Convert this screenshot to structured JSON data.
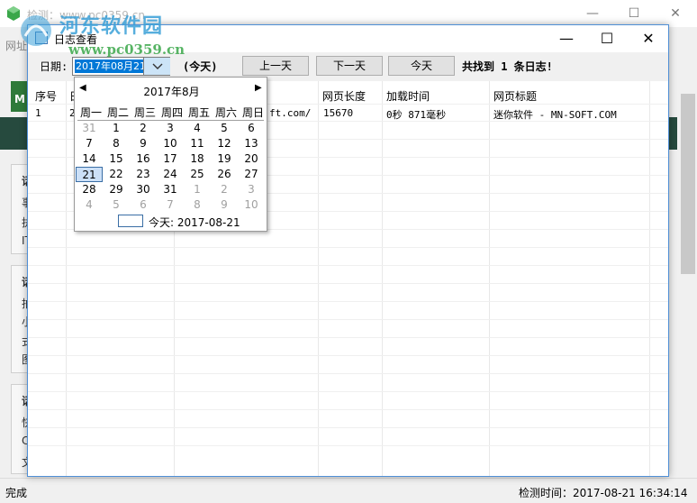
{
  "background_window": {
    "title": "检测：www.pc0359.cn",
    "url_label": "网址",
    "m_logo": "M",
    "side_glyphs": [
      "话",
      "事",
      "执",
      "IT",
      "话",
      "拍",
      "小",
      "式",
      "图",
      "话",
      "快",
      "C",
      "文"
    ],
    "status_left": "完成",
    "status_right": "检测时间：2017-08-21 16:34:14"
  },
  "watermark": {
    "text": "河东软件园",
    "url": "www.pc0359.cn"
  },
  "dialog": {
    "title": "日志查看",
    "date_label": "日期:",
    "date_value": "2017年08月21",
    "today_paren": "(今天)",
    "btn_prev": "上一天",
    "btn_next": "下一天",
    "btn_today": "今天",
    "found_text": "共找到 1 条日志!"
  },
  "table": {
    "headers": [
      "序号",
      "日",
      "网页长度",
      "加载时间",
      "网页标题"
    ],
    "rows": [
      [
        "1",
        "2",
        "ft.com/",
        "15670",
        "0秒 871毫秒",
        "迷你软件 - MN-SOFT.COM"
      ]
    ]
  },
  "calendar": {
    "title": "2017年8月",
    "weekdays": [
      "周一",
      "周二",
      "周三",
      "周四",
      "周五",
      "周六",
      "周日"
    ],
    "weeks": [
      [
        "31",
        "1",
        "2",
        "3",
        "4",
        "5",
        "6"
      ],
      [
        "7",
        "8",
        "9",
        "10",
        "11",
        "12",
        "13"
      ],
      [
        "14",
        "15",
        "16",
        "17",
        "18",
        "19",
        "20"
      ],
      [
        "21",
        "22",
        "23",
        "24",
        "25",
        "26",
        "27"
      ],
      [
        "28",
        "29",
        "30",
        "31",
        "1",
        "2",
        "3"
      ],
      [
        "4",
        "5",
        "6",
        "7",
        "8",
        "9",
        "10"
      ]
    ],
    "today_text": "今天: 2017-08-21"
  },
  "colors": {
    "dialog_border": "#4f8fd6",
    "dark_band": "#264a3e",
    "selection_bg": "#cce0f7"
  }
}
